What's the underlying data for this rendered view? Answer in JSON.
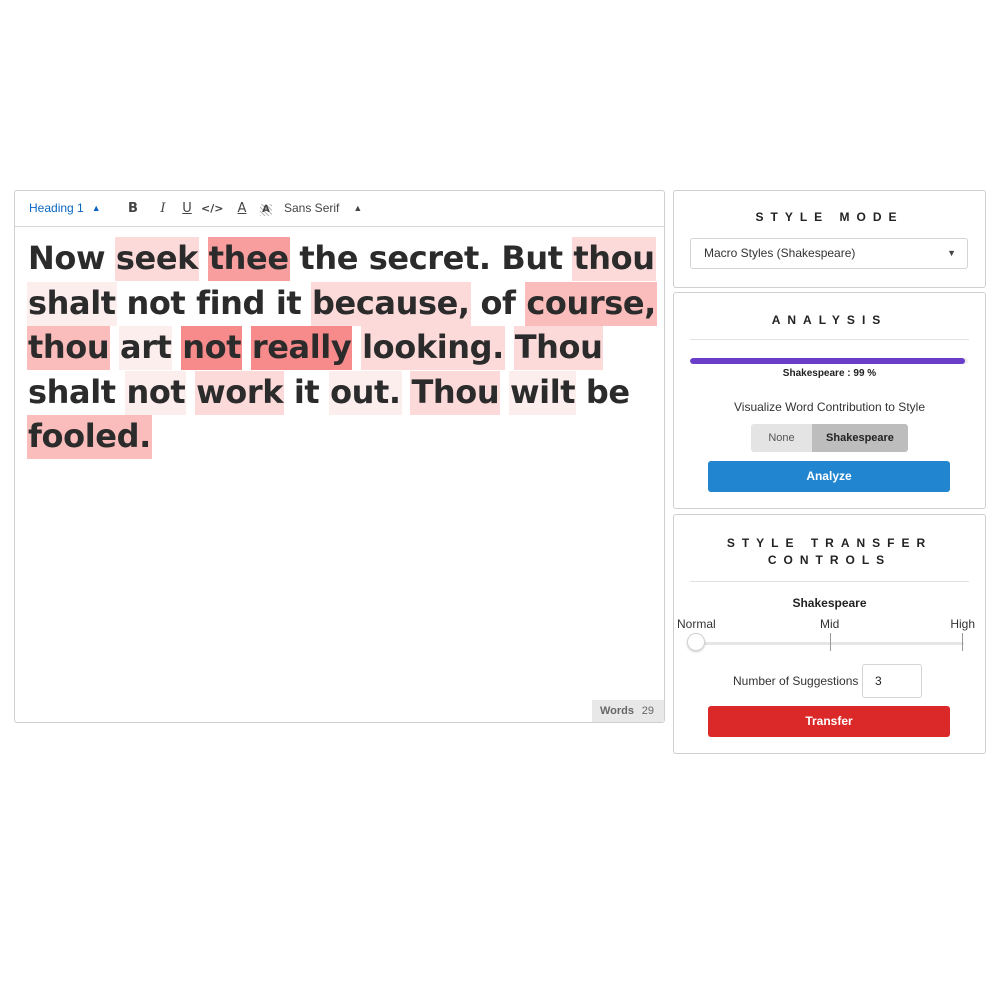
{
  "toolbar": {
    "heading_select": "Heading 1",
    "bold": "B",
    "italic": "I",
    "underline": "U",
    "code": "</>",
    "text_color": "A",
    "bg_color": "A",
    "font_select": "Sans Serif"
  },
  "editor": {
    "words": [
      {
        "t": "Now",
        "h": 0
      },
      {
        "t": "seek",
        "h": 2
      },
      {
        "t": "thee",
        "h": 4
      },
      {
        "t": "the",
        "h": 0
      },
      {
        "t": "secret.",
        "h": 0
      },
      {
        "t": "But",
        "h": 0
      },
      {
        "t": "thou",
        "h": 2
      },
      {
        "t": "shalt",
        "h": 1
      },
      {
        "t": "not",
        "h": 0
      },
      {
        "t": "find",
        "h": 0
      },
      {
        "t": "it",
        "h": 0
      },
      {
        "t": "because,",
        "h": 2
      },
      {
        "t": "of",
        "h": 0
      },
      {
        "t": "course,",
        "h": 3
      },
      {
        "t": "thou",
        "h": 3
      },
      {
        "t": "art",
        "h": 1
      },
      {
        "t": "not",
        "h": 5
      },
      {
        "t": "really",
        "h": 5
      },
      {
        "t": "looking.",
        "h": 2
      },
      {
        "t": "Thou",
        "h": 2
      },
      {
        "t": "shalt",
        "h": 0
      },
      {
        "t": "not",
        "h": 1
      },
      {
        "t": "work",
        "h": 2
      },
      {
        "t": "it",
        "h": 0
      },
      {
        "t": "out.",
        "h": 1
      },
      {
        "t": "Thou",
        "h": 2
      },
      {
        "t": "wilt",
        "h": 1
      },
      {
        "t": "be",
        "h": 0
      },
      {
        "t": "fooled.",
        "h": 3
      }
    ],
    "word_count_label": "Words",
    "word_count": "29"
  },
  "style_mode": {
    "title": "STYLE MODE",
    "selected": "Macro Styles (Shakespeare)"
  },
  "analysis": {
    "title": "ANALYSIS",
    "progress_fraction": 0.99,
    "progress_label": "Shakespeare : 99 %",
    "visualize_label": "Visualize Word Contribution to Style",
    "toggle_none": "None",
    "toggle_selected": "Shakespeare",
    "analyze_button": "Analyze"
  },
  "transfer": {
    "title_line1": "STYLE TRANSFER",
    "title_line2": "CONTROLS",
    "slider_title": "Shakespeare",
    "slider_normal": "Normal",
    "slider_mid": "Mid",
    "slider_high": "High",
    "suggestions_label": "Number of Suggestions",
    "suggestions_value": "3",
    "transfer_button": "Transfer"
  },
  "colors": {
    "accent_blue": "#2185d0",
    "accent_red": "#db2828",
    "progress_purple": "#6a3ec9"
  }
}
